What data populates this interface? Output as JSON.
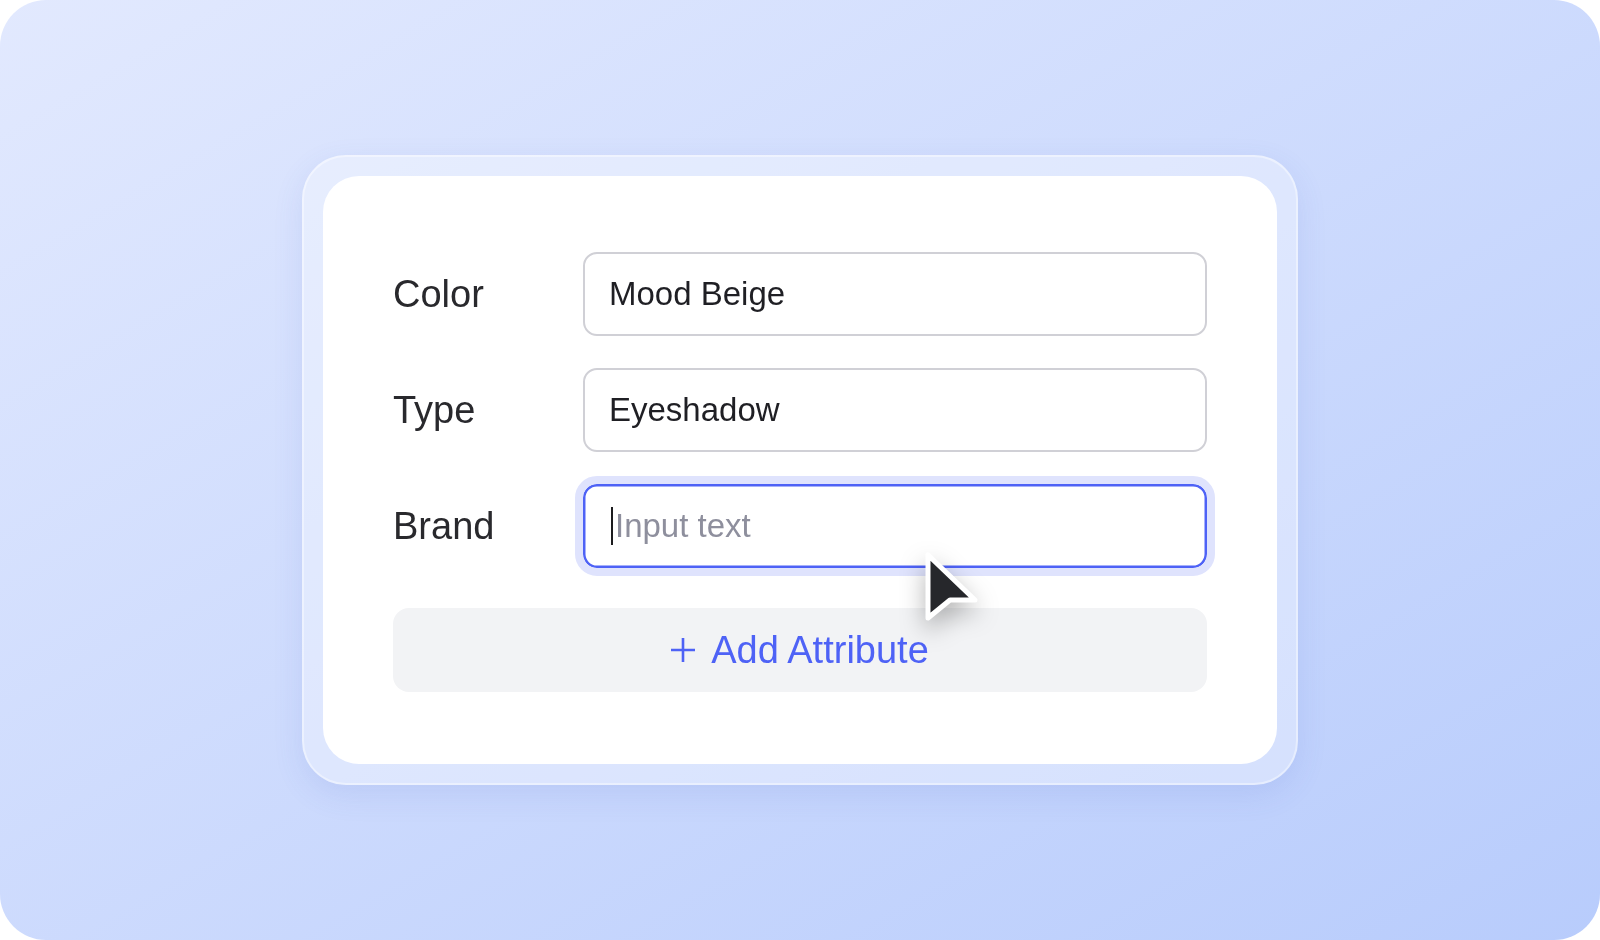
{
  "form": {
    "fields": [
      {
        "label": "Color",
        "value": "Mood Beige",
        "focused": false
      },
      {
        "label": "Type",
        "value": "Eyeshadow",
        "focused": false
      },
      {
        "label": "Brand",
        "placeholder": "Input text",
        "focused": true
      }
    ],
    "add_button": {
      "label": "Add Attribute"
    }
  }
}
